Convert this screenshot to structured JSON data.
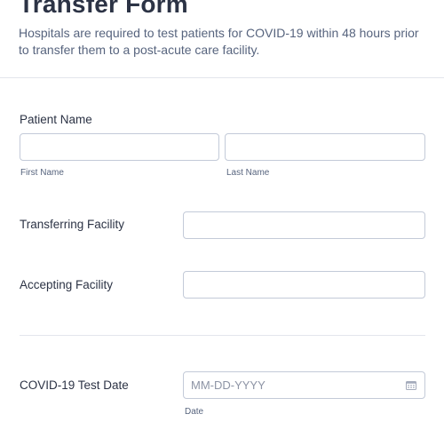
{
  "form": {
    "title": "Transfer Form",
    "subtitle": "Hospitals are required to test patients for COVID-19 within 48 hours prior to transfer them to a post-acute care facility."
  },
  "patient_name": {
    "label": "Patient Name",
    "first_value": "",
    "first_sublabel": "First Name",
    "last_value": "",
    "last_sublabel": "Last Name"
  },
  "transferring_facility": {
    "label": "Transferring Facility",
    "value": ""
  },
  "accepting_facility": {
    "label": "Accepting Facility",
    "value": ""
  },
  "covid_test_date": {
    "label": "COVID-19 Test Date",
    "placeholder": "MM-DD-YYYY",
    "value": "",
    "sublabel": "Date",
    "icon": "calendar-icon"
  },
  "colors": {
    "text": "#2c3345",
    "muted": "#57647e",
    "border": "#c3cad8",
    "divider": "#e3e5ec"
  }
}
